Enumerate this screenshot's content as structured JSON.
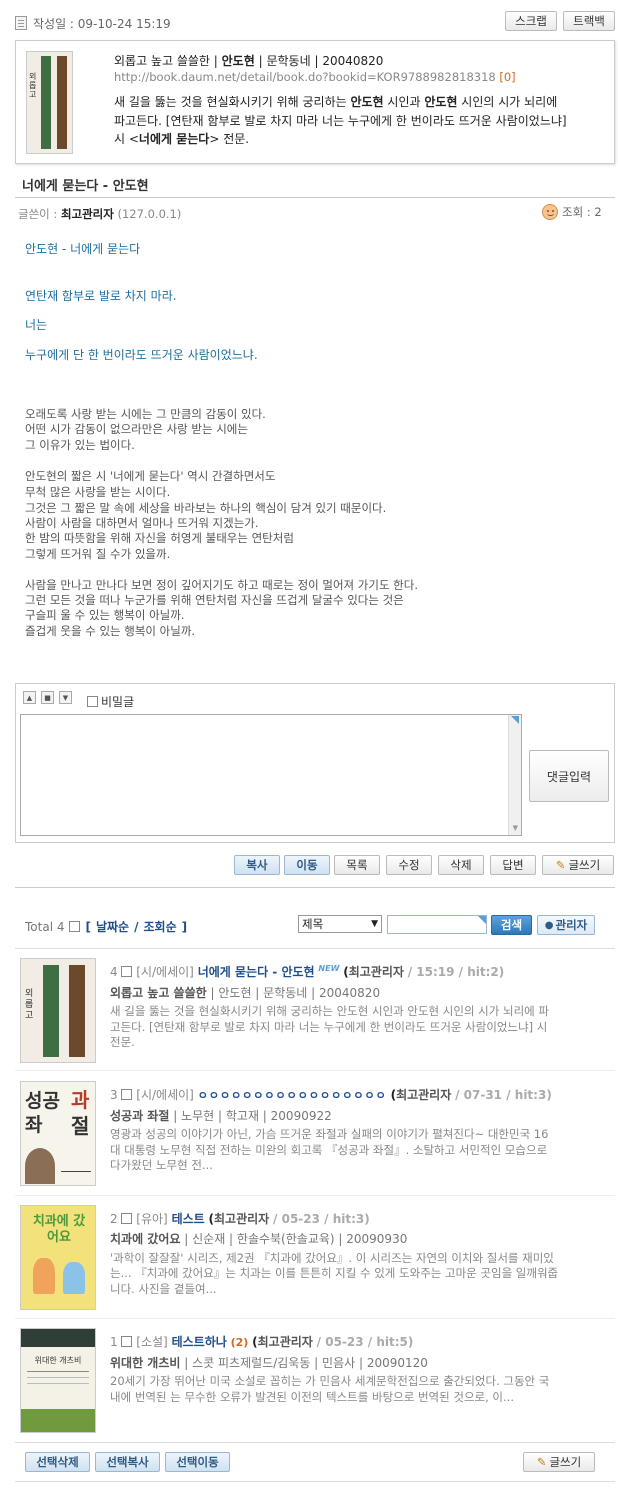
{
  "header": {
    "date_label": "작성일 : 09-10-24 15:19",
    "scrap_label": "스크랩",
    "trackback_label": "트랙백"
  },
  "book_card": {
    "title_line": "외롭고 높고 쓸쓸한",
    "author": "안도현",
    "publisher": "문학동네",
    "pub_date": "20040820",
    "url": "http://book.daum.net/detail/book.do?bookid=KOR9788982818318",
    "link_count": "[0]",
    "desc_line1_a": "새 길을 뚫는 것을 현실화시키기 위해 궁리하는 ",
    "desc_line1_b": "안도현",
    "desc_line1_c": " 시인과 ",
    "desc_line1_d": "안도현",
    "desc_line1_e": " 시인의 시가 뇌리에",
    "desc_line2": "파고든다. [연탄재 함부로 발로 차지 마라 너는 누구에게 한 번이라도 뜨거운 사람이었느냐]",
    "desc_line3_a": "시 <",
    "desc_line3_b": "너에게 묻는다",
    "desc_line3_c": "> 전문."
  },
  "post": {
    "title": "너에게 묻는다 - 안도현",
    "writer_label": "글쓴이 :",
    "writer": "최고관리자",
    "ip": "(127.0.0.1)",
    "views_label": "조회 : 2",
    "poem": [
      "안도현 - 너에게 묻는다",
      "연탄재 함부로 발로 차지 마라.",
      "너는",
      "누구에게 단 한 번이라도 뜨거운 사람이었느냐."
    ],
    "body": [
      "오래도록 사랑 받는 시에는 그 만큼의 감동이 있다.",
      "어떤 시가 감동이 없으라만은 사랑 받는 시에는",
      "그 이유가 있는 법이다.",
      "안도현의 짧은 시 '너에게 묻는다' 역시 간결하면서도",
      "무척 많은 사랑을 받는 시이다.",
      "그것은 그 짧은 말 속에 세상을 바라보는 하나의 핵심이 담겨 있기 때문이다.",
      "사람이 사람을 대하면서 얼마나 뜨거워 지겠는가.",
      "한 밤의 따뜻함을 위해 자신을 허영게 불태우는 연탄처럼",
      "그렇게 뜨거워 질 수가 있을까.",
      "사람을 만나고 만나다 보면 정이 깊어지기도 하고 때로는 정이 멀어져 가기도 한다.",
      "그런 모든 것을 떠나 누군가를 위해 연탄처럼 자신을 뜨겁게 달굴수 있다는 것은",
      "구슬피 울 수 있는 행복이 아닐까.",
      "즐겁게 웃을 수 있는 행복이 아닐까."
    ]
  },
  "comment": {
    "secret_label": "비밀글",
    "submit_label": "댓글입력"
  },
  "actions": {
    "copy": "복사",
    "move": "이동",
    "list": "목록",
    "edit": "수정",
    "delete": "삭제",
    "reply": "답변",
    "write": "글쓰기"
  },
  "list_toolbar": {
    "total_label": "Total 4",
    "sort_by_date": "날짜순",
    "sort_sep": "/",
    "sort_by_views": "조회순",
    "field_select": "제목",
    "search_button": "검색",
    "admin_button": "관리자"
  },
  "items": [
    {
      "num": "4",
      "category": "[시/에세이]",
      "title": "너에게 묻는다 - 안도현",
      "badge": "NEW",
      "comments": "",
      "author": "최고관리자",
      "meta": "/ 15:19 / hit:2)",
      "book_title": "외롭고 높고 쓸쓸한",
      "book_info": "| 안도현 | 문학동네 | 20040820",
      "desc": [
        "새 길을 뚫는 것을 현실화시키기 위해 궁리하는 안도현 시인과 안도현 시인의 시가 뇌리에 파",
        "고든다. [연탄재 함부로 발로 차지 마라 너는 누구에게 한 번이라도 뜨거운 사람이었느냐] 시",
        "전문."
      ]
    },
    {
      "num": "3",
      "category": "[시/에세이]",
      "title": "ㅇㅇㅇㅇㅇㅇㅇㅇㅇㅇㅇㅇㅇㅇㅇㅇㅇ",
      "badge": "",
      "comments": "",
      "author": "최고관리자",
      "meta": "/ 07-31 / hit:3)",
      "book_title": "성공과 좌절",
      "book_info": "| 노무현 | 학고재 | 20090922",
      "desc": [
        "영광과 성공의 이야기가 아닌, 가슴 뜨거운 좌절과 실패의 이야기가 펼쳐진다~ 대한민국 16",
        "대 대통령 노무현 직접 전하는 미완의 회고록 『성공과 좌절』. 소탈하고 서민적인 모습으로",
        "다가왔던 노무현 전..."
      ]
    },
    {
      "num": "2",
      "category": "[유아]",
      "title": "테스트",
      "badge": "",
      "comments": "",
      "author": "최고관리자",
      "meta": "/ 05-23 / hit:3)",
      "book_title": "치과에 갔어요",
      "book_info": "| 신순재 | 한솔수북(한솔교육) | 20090930",
      "desc": [
        "'과학이 잘잘잘' 시리즈, 제2권 『치과에 갔어요』. 이 시리즈는 자연의 이치와 질서를 재미있",
        "는... 『치과에 갔어요』는 치과는 이를 튼튼히 지킬 수 있게 도와주는 고마운 곳임을 일깨워줍",
        "니다. 사진을 곁들여..."
      ]
    },
    {
      "num": "1",
      "category": "[소설]",
      "title": "테스트하나",
      "badge": "",
      "comments": "(2)",
      "author": "최고관리자",
      "meta": "/ 05-23 / hit:5)",
      "book_title": "위대한 개츠비",
      "book_info": "| 스콧 피츠제럴드/김욱동 | 민음사 | 20090120",
      "desc": [
        "20세기 가장 뛰어난 미국 소설로 꼽히는 가 민음사 세계문학전집으로 출간되었다. 그동안 국",
        "내에 번역된 는 무수한 오류가 발견된 이전의 텍스트를 바탕으로 번역된 것으로, 이..."
      ]
    }
  ],
  "covers": {
    "c1_text": "외롭고",
    "c2_big1": "성공",
    "c2_big2": "과",
    "c2_big3": "좌",
    "c2_big4": "절",
    "c3_text": "치과에 갔어요",
    "c4_text": "위대한 개츠비"
  },
  "bottom": {
    "sel_delete": "선택삭제",
    "sel_copy": "선택복사",
    "sel_move": "선택이동",
    "write": "글쓰기"
  },
  "colors": {
    "accent_blue": "#1f4e8d",
    "poem_blue": "#1f6e9e",
    "comment_orange": "#d9661f"
  }
}
